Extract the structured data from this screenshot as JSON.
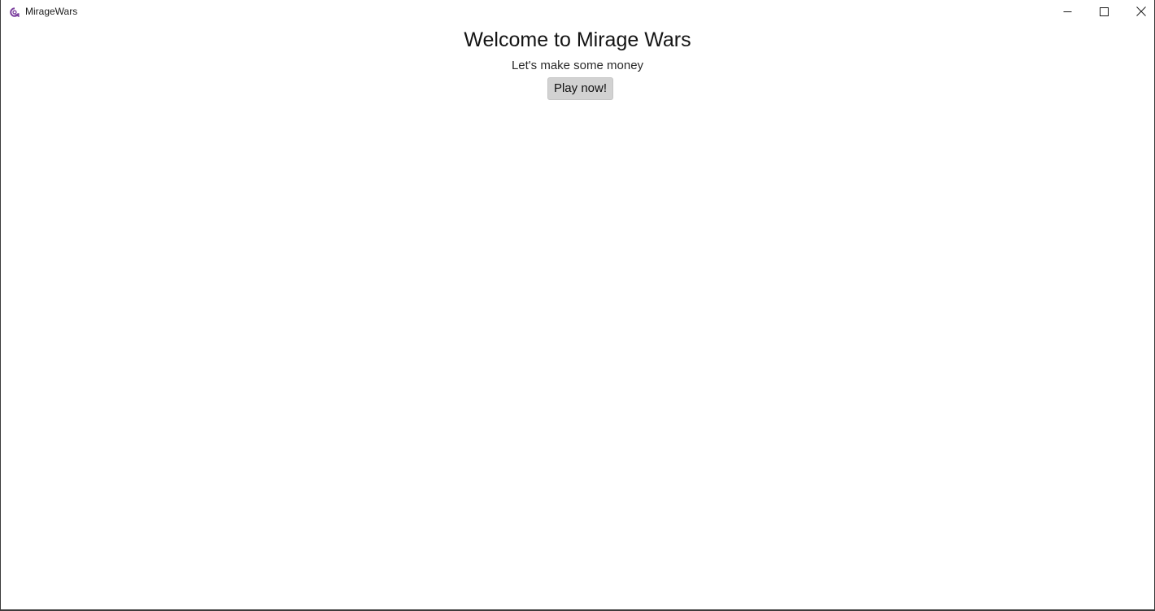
{
  "window": {
    "title": "MirageWars",
    "icon": "app-logo-icon",
    "controls": {
      "minimize_icon": "minimize-icon",
      "maximize_icon": "maximize-icon",
      "close_icon": "close-icon"
    },
    "accent_color": "#7b3f9e"
  },
  "main": {
    "title": "Welcome to Mirage Wars",
    "subtitle": "Let's make some money",
    "play_button_label": "Play now!"
  }
}
